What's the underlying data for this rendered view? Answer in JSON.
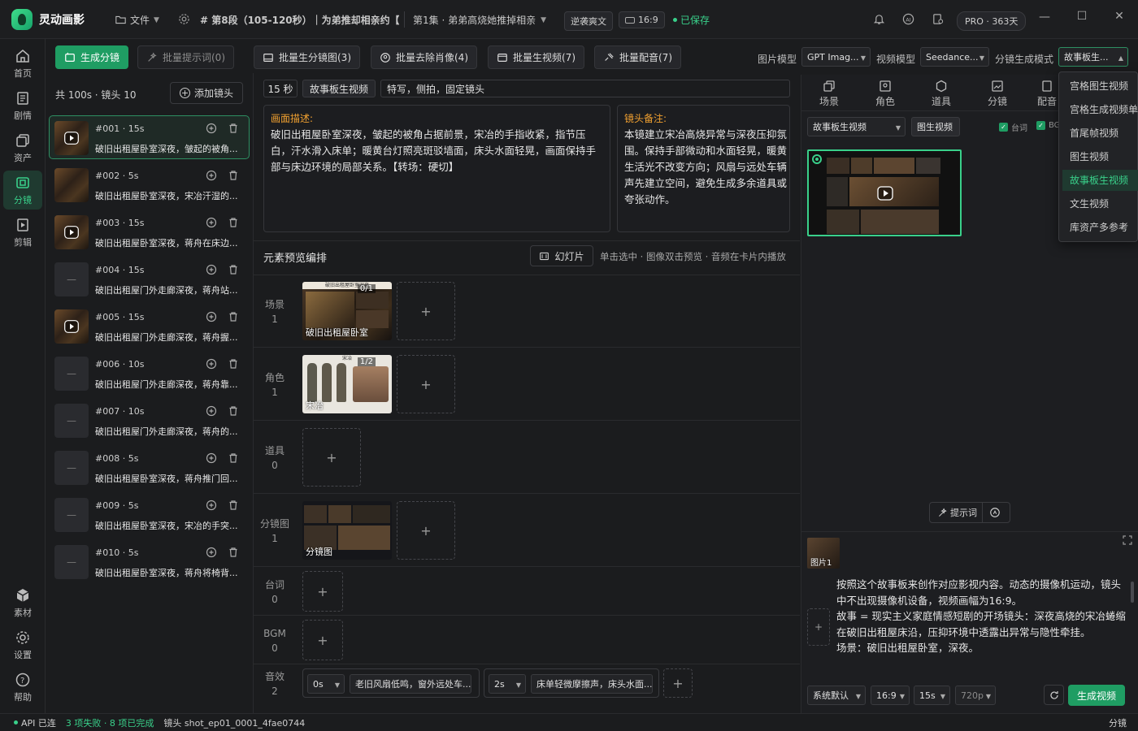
{
  "app": {
    "name": "灵动画影"
  },
  "titlebar": {
    "file_menu": "文件",
    "segment": "# 第8段（105-120秒）｜为弟推却相亲约【...",
    "episode": "第1集 · 弟弟高烧她推掉相亲",
    "tag": "逆袭爽文",
    "ratio": "16:9",
    "saved": "已保存",
    "plan": "PRO · 363天"
  },
  "nav": {
    "items": [
      {
        "label": "首页"
      },
      {
        "label": "剧情"
      },
      {
        "label": "资产"
      },
      {
        "label": "分镜"
      },
      {
        "label": "剪辑"
      },
      {
        "label": "素材"
      },
      {
        "label": "设置"
      },
      {
        "label": "帮助"
      }
    ]
  },
  "toolbar": {
    "generate_shots": "生成分镜",
    "batch_prompts": "批量提示词(0)",
    "batch_storyboard": "批量生分镜图(3)",
    "batch_remove_portrait": "批量去除肖像(4)",
    "batch_video": "批量生视频(7)",
    "batch_dub": "批量配音(7)",
    "image_model_label": "图片模型",
    "image_model": "GPT Imag...",
    "video_model_label": "视频模型",
    "video_model": "Seedance...",
    "shot_mode_label": "分镜生成模式",
    "shot_mode": "故事板生..."
  },
  "shotlist": {
    "summary": "共 100s · 镜头 10",
    "add_shot": "添加镜头",
    "shots": [
      {
        "id": "#001 · 15s",
        "desc": "破旧出租屋卧室深夜，皱起的被角..."
      },
      {
        "id": "#002 · 5s",
        "desc": "破旧出租屋卧室深夜，宋冶汗湿的..."
      },
      {
        "id": "#003 · 15s",
        "desc": "破旧出租屋卧室深夜，蒋舟在床边..."
      },
      {
        "id": "#004 · 15s",
        "desc": "破旧出租屋门外走廊深夜，蒋舟站..."
      },
      {
        "id": "#005 · 15s",
        "desc": "破旧出租屋门外走廊深夜，蒋舟握..."
      },
      {
        "id": "#006 · 10s",
        "desc": "破旧出租屋门外走廊深夜，蒋舟靠..."
      },
      {
        "id": "#007 · 10s",
        "desc": "破旧出租屋门外走廊深夜，蒋舟的..."
      },
      {
        "id": "#008 · 5s",
        "desc": "破旧出租屋卧室深夜，蒋舟推门回..."
      },
      {
        "id": "#009 · 5s",
        "desc": "破旧出租屋卧室深夜，宋冶的手突..."
      },
      {
        "id": "#010 · 5s",
        "desc": "破旧出租屋卧室深夜，蒋舟将椅背..."
      }
    ]
  },
  "editor": {
    "duration": "15 秒",
    "gen_mode": "故事板生视频",
    "shot_type": "特写，侧拍，固定镜头",
    "desc_label": "画面描述:",
    "desc_text": "破旧出租屋卧室深夜，皱起的被角占据前景，宋冶的手指收紧，指节压白，汗水滑入床单；暖黄台灯照亮斑驳墙面，床头水面轻晃，画面保持手部与床边环境的局部关系。【转场：硬切】",
    "note_label": "镜头备注:",
    "note_text": "本镜建立宋冶高烧异常与深夜压抑氛围。保持手部微动和水面轻晃，暖黄生活光不改变方向；风扇与远处车辆声先建立空间，避免生成多余道具或夸张动作。",
    "preview_title": "元素预览编排",
    "slideshow": "幻灯片",
    "preview_hint": "单击选中 · 图像双击预览 · 音频在卡片内播放",
    "rows": [
      {
        "name": "场景",
        "count": "1"
      },
      {
        "name": "角色",
        "count": "1"
      },
      {
        "name": "道具",
        "count": "0"
      },
      {
        "name": "分镜图",
        "count": "1"
      },
      {
        "name": "台词",
        "count": "0"
      },
      {
        "name": "BGM",
        "count": "0"
      },
      {
        "name": "音效",
        "count": "2"
      }
    ],
    "scene_card": {
      "caption": "破旧出租屋卧室",
      "counter": "0/1",
      "header": "破旧出租屋卧室深夜"
    },
    "char_card": {
      "caption": "宋冶",
      "counter": "1/2",
      "header": "宋冶"
    },
    "storyboard_card": {
      "caption": "分镜图"
    },
    "sfx": [
      {
        "time": "0s",
        "text": "老旧风扇低鸣，窗外远处车..."
      },
      {
        "time": "2s",
        "text": "床单轻微摩擦声，床头水面..."
      }
    ]
  },
  "right": {
    "tabs": [
      "场景",
      "角色",
      "道具",
      "分镜",
      "配音"
    ],
    "mode_select": "故事板生视频",
    "img2video_btn": "图生视频",
    "chk_dialog": "台词",
    "chk_bgm": "BG",
    "prompt_btn": "提示词",
    "ref_label": "图片1",
    "prompt_text": "按照这个故事板来创作对应影视内容。动态的摄像机运动，镜头中不出现摄像机设备，视频画幅为16:9。\n故事 = 现实主义家庭情感短剧的开场镜头：深夜高烧的宋冶蜷缩在破旧出租屋床沿，压抑环境中透露出异常与隐性牵挂。\n场景：破旧出租屋卧室，深夜。",
    "sys_default": "系统默认",
    "ratio": "16:9",
    "duration": "15s",
    "resolution": "720p",
    "generate": "生成视频"
  },
  "dropdown": {
    "items": [
      "宫格图生视频",
      "宫格生成视频单",
      "首尾帧视频",
      "图生视频",
      "故事板生视频",
      "文生视频",
      "库资产多参考"
    ],
    "selected": "故事板生视频"
  },
  "status": {
    "api": "API 已连",
    "tasks": "3 项失败 · 8 项已完成",
    "shot": "镜头 shot_ep01_0001_4fae0744",
    "right": "分镜"
  },
  "colors": {
    "accent": "#39d08a",
    "label": "#f0a030",
    "bg": "#1b1c1e"
  }
}
